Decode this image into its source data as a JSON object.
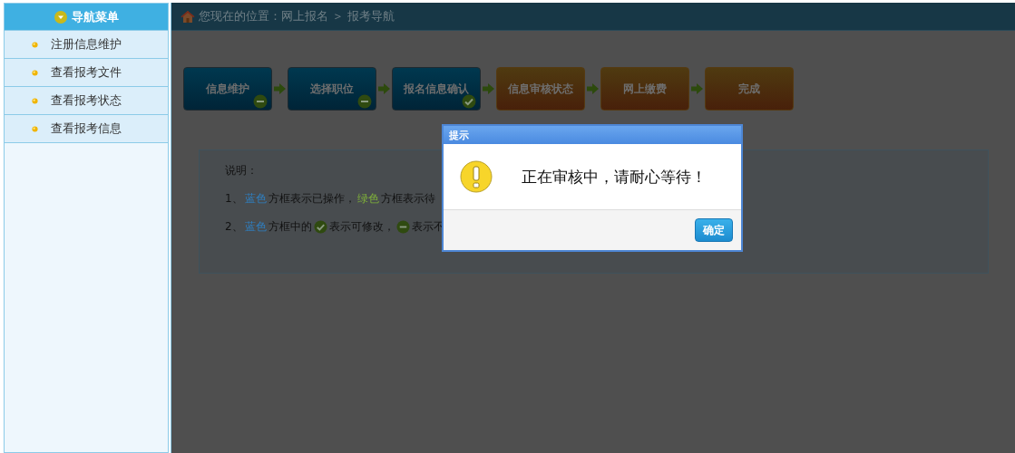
{
  "sidebar": {
    "title": "导航菜单",
    "items": [
      {
        "label": "注册信息维护"
      },
      {
        "label": "查看报考文件"
      },
      {
        "label": "查看报考状态"
      },
      {
        "label": "查看报考信息"
      }
    ]
  },
  "breadcrumb": "您现在的位置：网上报名 ＞ 报考导航",
  "steps": [
    {
      "label": "信息维护",
      "kind": "blue",
      "editable": false
    },
    {
      "label": "选择职位",
      "kind": "blue",
      "editable": false
    },
    {
      "label": "报名信息确认",
      "kind": "blue",
      "editable": true
    },
    {
      "label": "信息审核状态",
      "kind": "orange"
    },
    {
      "label": "网上缴费",
      "kind": "orange"
    },
    {
      "label": "完成",
      "kind": "orange"
    }
  ],
  "notes": {
    "title": "说明：",
    "lines": [
      [
        {
          "kind": "text",
          "text": "1、"
        },
        {
          "kind": "text",
          "text": "蓝色",
          "color": "#2f7fc0"
        },
        {
          "kind": "text",
          "text": "方框表示已操作，"
        },
        {
          "kind": "text",
          "text": "绿色",
          "color": "#7fb03a"
        },
        {
          "kind": "text",
          "text": "方框表示待"
        }
      ],
      [
        {
          "kind": "text",
          "text": "2、"
        },
        {
          "kind": "text",
          "text": "蓝色",
          "color": "#2f7fc0"
        },
        {
          "kind": "text",
          "text": "方框中的"
        },
        {
          "kind": "check"
        },
        {
          "kind": "text",
          "text": "表示可修改，"
        },
        {
          "kind": "minus"
        },
        {
          "kind": "text",
          "text": "表示不"
        }
      ]
    ]
  },
  "dialog": {
    "title": "提示",
    "message": "正在审核中，请耐心等待！",
    "button": "确定"
  }
}
